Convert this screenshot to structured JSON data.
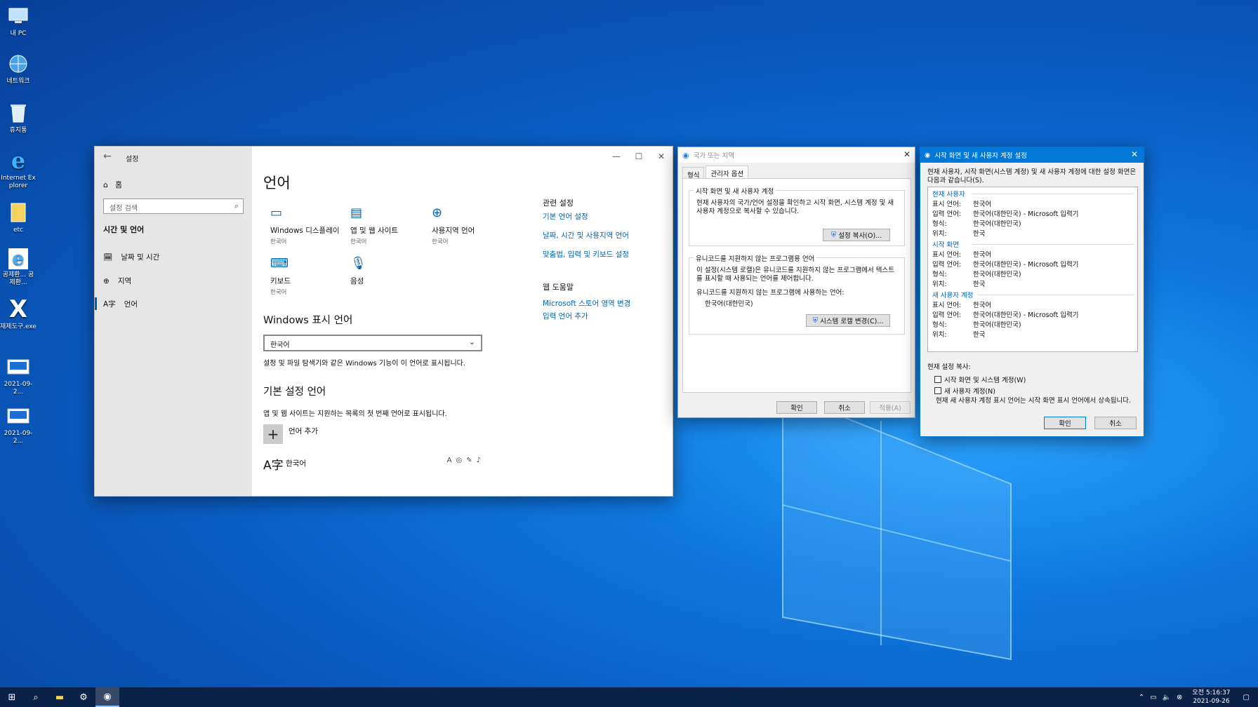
{
  "desktop_icons": [
    {
      "label": "내 PC",
      "icon": "computer-icon"
    },
    {
      "label": "네트워크",
      "icon": "network-icon"
    },
    {
      "label": "휴지통",
      "icon": "recycle-bin-icon"
    },
    {
      "label": "Internet Explorer",
      "icon": "ie-icon"
    },
    {
      "label": "etc",
      "icon": "folder-icon"
    },
    {
      "label": "공제환... 공제환...",
      "icon": "ie-shortcut-icon"
    },
    {
      "label": "재제도구.exe",
      "icon": "x-app-icon"
    },
    {
      "label": "2021-09-2...",
      "icon": "image-file-icon"
    },
    {
      "label": "2021-09-2...",
      "icon": "image-file-icon"
    }
  ],
  "settings": {
    "title": "설정",
    "home": "홈",
    "search_placeholder": "설정 검색",
    "category": "시간 및 언어",
    "nav": [
      "날짜 및 시간",
      "지역",
      "언어"
    ],
    "page_title": "언어",
    "tiles": [
      {
        "title": "Windows 디스플레이",
        "sub": "한국어"
      },
      {
        "title": "앱 및 웹 사이트",
        "sub": "한국어"
      },
      {
        "title": "사용지역 언어",
        "sub": "한국어"
      },
      {
        "title": "키보드",
        "sub": "한국어"
      },
      {
        "title": "음성",
        "sub": ""
      }
    ],
    "display_lang_heading": "Windows 표시 언어",
    "display_lang_value": "한국어",
    "display_lang_desc": "설정 및 파일 탐색기와 같은 Windows 기능이 이 언어로 표시됩니다.",
    "preferred_heading": "기본 설정 언어",
    "preferred_desc": "앱 및 웹 사이트는 지원하는 목록의 첫 번째 언어로 표시됩니다.",
    "add_language": "언어 추가",
    "language_item": "한국어",
    "related_heading": "관련 설정",
    "related_links": [
      "기본 언어 설정",
      "날짜, 시간 및 사용지역 언어",
      "맞춤법, 입력 및 키보드 설정"
    ],
    "help_heading": "웹 도움말",
    "help_links": [
      "Microsoft 스토어 영역 변경",
      "입력 언어 추가"
    ]
  },
  "region": {
    "title": "국가 또는 지역",
    "tabs": [
      "형식",
      "관리자 옵션"
    ],
    "group1_label": "시작 화면 및 새 사용자 계정",
    "group1_text": "현재 사용자의 국가/언어 설정을 확인하고 시작 화면, 시스템 계정 및 새 사용자 계정으로 복사할 수 있습니다.",
    "copy_button": "설정 복사(O)...",
    "group2_label": "유니코드를 지원하지 않는 프로그램용 언어",
    "group2_text": "이 설정(시스템 로캘)은 유니코드를 지원하지 않는 프로그램에서 텍스트를 표시할 때 사용되는 언어를 제어합니다.",
    "current_label": "유니코드를 지원하지 않는 프로그램에 사용하는 언어:",
    "current_value": "한국어(대한민국)",
    "change_button": "시스템 로캘 변경(C)...",
    "ok": "확인",
    "cancel": "취소",
    "apply": "적용(A)"
  },
  "copy_dialog": {
    "title": "시작 화면 및 새 사용자 계정 설정",
    "intro": "현재 사용자, 시작 화면(시스템 계정) 및 새 사용자 계정에 대한 설정 화면은 다음과 같습니다(S).",
    "sections": [
      {
        "name": "현재 사용자",
        "rows": [
          {
            "k": "표시 언어:",
            "v": "한국어"
          },
          {
            "k": "입력 언어:",
            "v": "한국어(대한민국) - Microsoft 입력기"
          },
          {
            "k": "형식:",
            "v": "한국어(대한민국)"
          },
          {
            "k": "위치:",
            "v": "한국"
          }
        ]
      },
      {
        "name": "시작 화면",
        "rows": [
          {
            "k": "표시 언어:",
            "v": "한국어"
          },
          {
            "k": "입력 언어:",
            "v": "한국어(대한민국) - Microsoft 입력기"
          },
          {
            "k": "형식:",
            "v": "한국어(대한민국)"
          },
          {
            "k": "위치:",
            "v": "한국"
          }
        ]
      },
      {
        "name": "새 사용자 계정",
        "rows": [
          {
            "k": "표시 언어:",
            "v": "한국어"
          },
          {
            "k": "입력 언어:",
            "v": "한국어(대한민국) - Microsoft 입력기"
          },
          {
            "k": "형식:",
            "v": "한국어(대한민국)"
          },
          {
            "k": "위치:",
            "v": "한국"
          }
        ]
      }
    ],
    "copy_label": "현재 설정 복사:",
    "check1": "시작 화면 및 시스템 계정(W)",
    "check2": "새 사용자 계정(N)",
    "note": "현재 새 사용자 계정 표시 언어는 시작 화면 표시 언어에서 상속됩니다.",
    "ok": "확인",
    "cancel": "취소"
  },
  "taskbar": {
    "time": "오전 5:16:37",
    "date": "2021-09-26"
  }
}
